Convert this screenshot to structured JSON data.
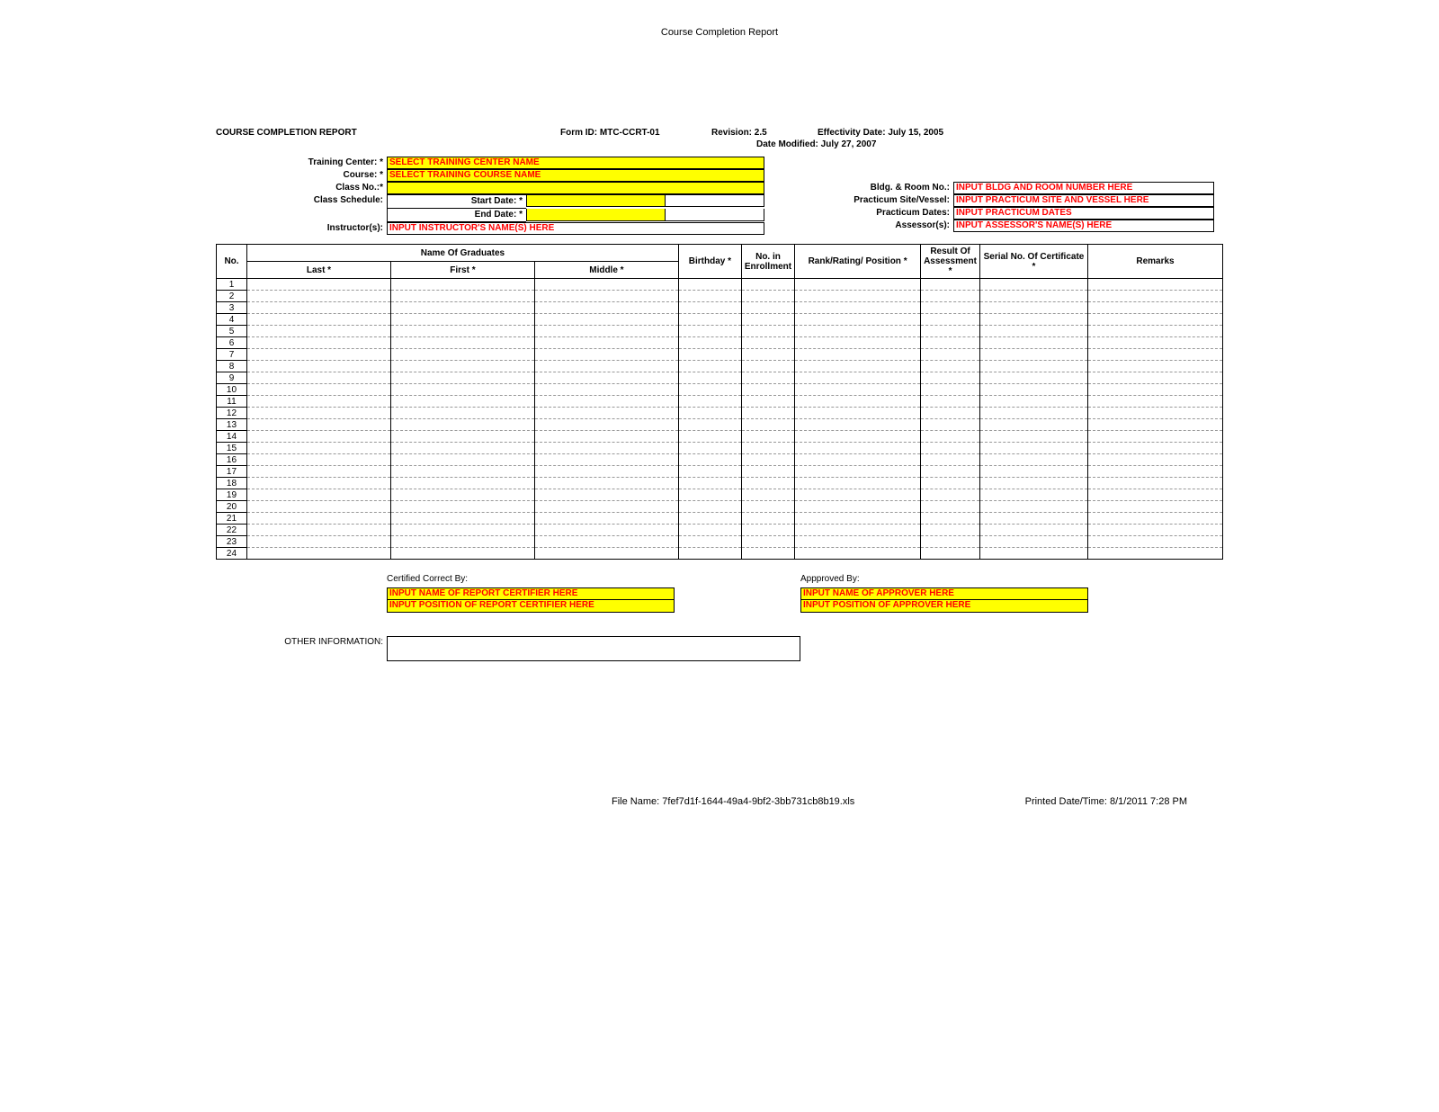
{
  "doc_title": "Course Completion Report",
  "header": {
    "main_title": "COURSE COMPLETION REPORT",
    "form_id_label": "Form ID:",
    "form_id": "MTC-CCRT-01",
    "revision_label": "Revision:",
    "revision": "2.5",
    "effectivity_label": "Effectivity Date:",
    "effectivity": "July 15, 2005",
    "modified_label": "Date Modified:",
    "modified": "July 27, 2007"
  },
  "left_info": {
    "training_center_label": "Training Center: *",
    "training_center_value": "SELECT TRAINING CENTER NAME",
    "course_label": "Course: *",
    "course_value": "SELECT TRAINING COURSE NAME",
    "class_no_label": "Class No.:*",
    "class_no_value": "",
    "class_schedule_label": "Class Schedule:",
    "start_date_label": "Start Date: *",
    "start_date_value": "",
    "end_date_label": "End Date: *",
    "end_date_value": "",
    "instructors_label": "Instructor(s):",
    "instructors_value": "INPUT INSTRUCTOR'S NAME(S) HERE"
  },
  "right_info": {
    "bldg_label": "Bldg. & Room No.:",
    "bldg_value": "INPUT BLDG AND ROOM NUMBER HERE",
    "practicum_site_label": "Practicum Site/Vessel:",
    "practicum_site_value": "INPUT PRACTICUM SITE AND VESSEL HERE",
    "practicum_dates_label": "Practicum Dates:",
    "practicum_dates_value": "INPUT PRACTICUM  DATES",
    "assessor_label": "Assessor(s):",
    "assessor_value": "INPUT ASSESSOR'S NAME(S) HERE"
  },
  "table": {
    "headers": {
      "no": "No.",
      "name_group": "Name Of Graduates",
      "last": "Last *",
      "first": "First *",
      "middle": "Middle *",
      "birthday": "Birthday *",
      "enroll": "No. in Enrollment",
      "rank": "Rank/Rating/ Position *",
      "result": "Result Of Assessment *",
      "serial": "Serial No. Of Certificate *",
      "remarks": "Remarks"
    },
    "rows": [
      1,
      2,
      3,
      4,
      5,
      6,
      7,
      8,
      9,
      10,
      11,
      12,
      13,
      14,
      15,
      16,
      17,
      18,
      19,
      20,
      21,
      22,
      23,
      24
    ]
  },
  "signatures": {
    "certified_label": "Certified Correct By:",
    "certified_name": "INPUT NAME OF REPORT CERTIFIER HERE",
    "certified_pos": "INPUT POSITION OF REPORT CERTIFIER HERE",
    "approved_label": "Appproved By:",
    "approved_name": "INPUT NAME OF APPROVER HERE",
    "approved_pos": "INPUT POSITION OF APPROVER HERE"
  },
  "other_info_label": "OTHER INFORMATION:",
  "footer": {
    "filename_label": "File Name:",
    "filename": "7fef7d1f-1644-49a4-9bf2-3bb731cb8b19.xls",
    "printed_label": "Printed Date/Time:",
    "printed": "8/1/2011 7:28 PM"
  }
}
